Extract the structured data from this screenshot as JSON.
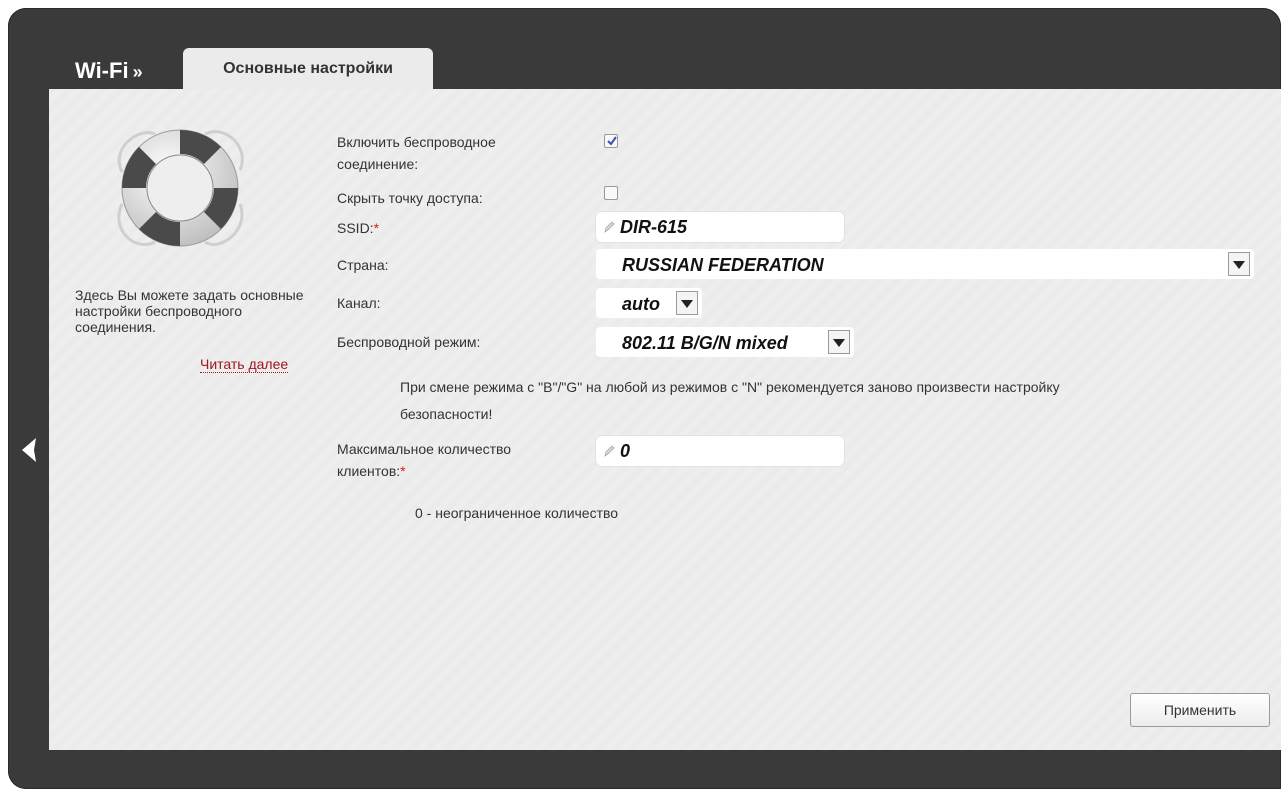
{
  "header": {
    "section_title": "Wi-Fi",
    "separator": "»",
    "active_tab": "Основные настройки"
  },
  "help": {
    "text": "Здесь Вы можете задать основные настройки беспроводного соединения.",
    "read_more": "Читать далее"
  },
  "form": {
    "enable_wireless": {
      "label_line1": "Включить беспроводное",
      "label_line2": "соединение:",
      "checked": true
    },
    "hide_ap": {
      "label": "Скрыть точку доступа:",
      "checked": false
    },
    "ssid": {
      "label": "SSID:",
      "required_mark": "*",
      "value": "DIR-615"
    },
    "country": {
      "label": "Страна:",
      "value": "RUSSIAN FEDERATION"
    },
    "channel": {
      "label": "Канал:",
      "value": "auto"
    },
    "wireless_mode": {
      "label": "Беспроводной режим:",
      "value": "802.11 B/G/N mixed",
      "note_line1": "При смене режима с \"B\"/\"G\" на любой из режимов с \"N\" рекомендуется заново произвести настройку",
      "note_line2": "безопасности!"
    },
    "max_clients": {
      "label_line1": "Максимальное количество",
      "label_line2": "клиентов:",
      "required_mark": "*",
      "value": "0",
      "note": "0 - неограниченное количество"
    }
  },
  "actions": {
    "apply_label": "Применить"
  },
  "colors": {
    "frame": "#3a3a3a",
    "panel": "#eeeeee",
    "required": "#d82020",
    "link": "#a0161b"
  }
}
